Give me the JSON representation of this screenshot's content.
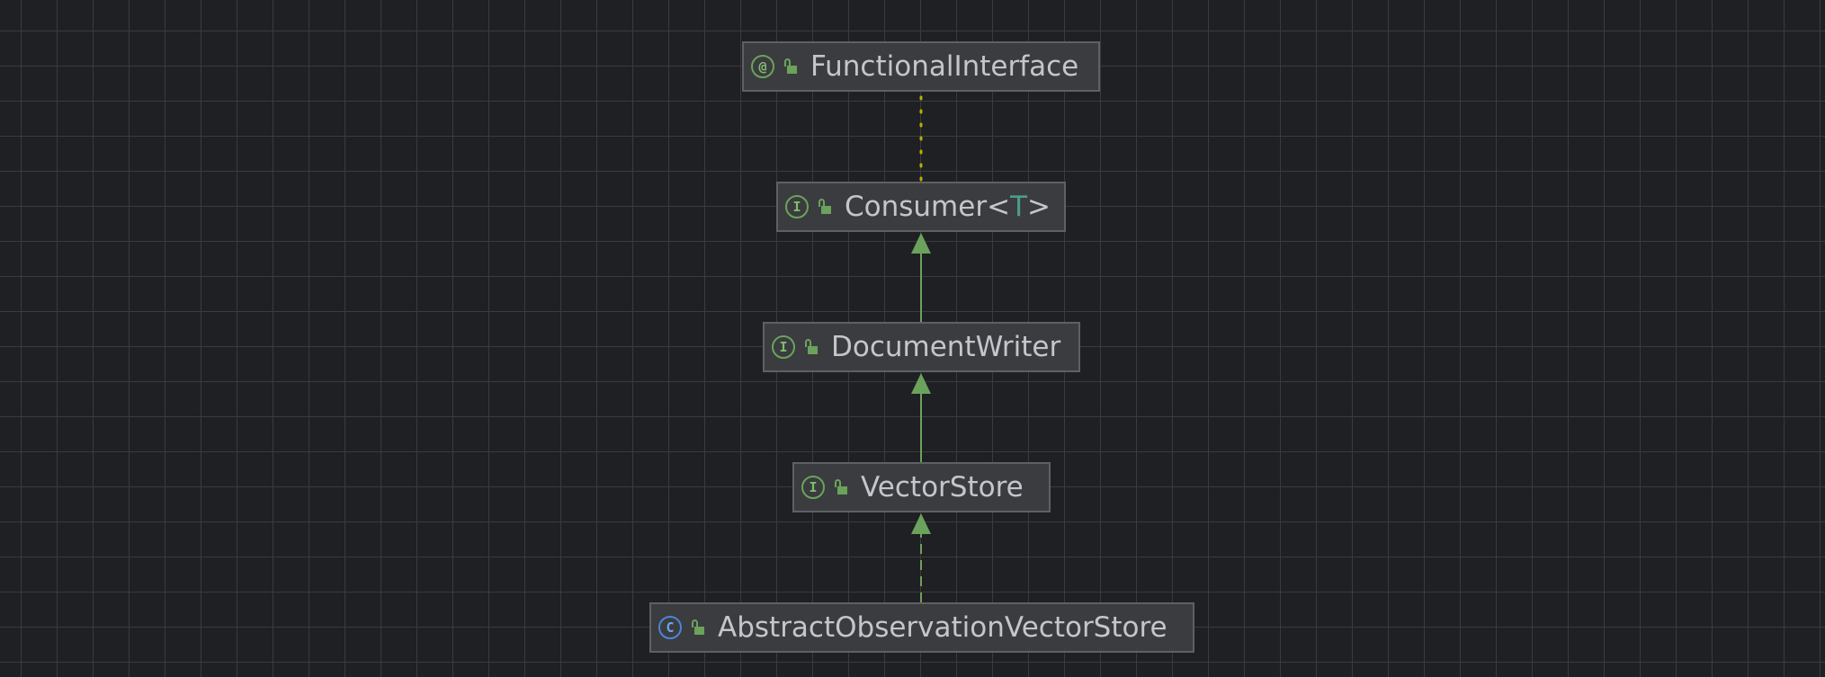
{
  "diagram": {
    "nodes": [
      {
        "id": "functional-interface",
        "kind": "annotation",
        "kind_glyph": "@",
        "visibility_icon": "unlocked-icon",
        "label": "FunctionalInterface"
      },
      {
        "id": "consumer",
        "kind": "interface",
        "kind_glyph": "I",
        "visibility_icon": "unlocked-icon",
        "label": "Consumer<",
        "type_param": "T",
        "label_suffix": ">"
      },
      {
        "id": "document-writer",
        "kind": "interface",
        "kind_glyph": "I",
        "visibility_icon": "unlocked-icon",
        "label": "DocumentWriter"
      },
      {
        "id": "vector-store",
        "kind": "interface",
        "kind_glyph": "I",
        "visibility_icon": "unlocked-icon",
        "label": "VectorStore"
      },
      {
        "id": "abstract-observation-vector-store",
        "kind": "class",
        "kind_glyph": "C",
        "visibility_icon": "unlocked-icon",
        "label": "AbstractObservationVectorStore"
      }
    ],
    "edges": [
      {
        "from": "consumer",
        "to": "functional-interface",
        "relation": "annotated-by",
        "style": "dotted",
        "color": "#b8b000"
      },
      {
        "from": "document-writer",
        "to": "consumer",
        "relation": "extends",
        "style": "solid",
        "color": "#6ba25c"
      },
      {
        "from": "vector-store",
        "to": "document-writer",
        "relation": "extends",
        "style": "solid",
        "color": "#6ba25c"
      },
      {
        "from": "abstract-observation-vector-store",
        "to": "vector-store",
        "relation": "implements",
        "style": "dashed",
        "color": "#6ba25c"
      }
    ]
  },
  "colors": {
    "background": "#1f2023",
    "grid": "#3a3b3f",
    "node_fill": "#3b3c3f",
    "node_border": "#5e6064",
    "text": "#c3c6cc",
    "interface_accent": "#6ba25c",
    "class_accent": "#4a86d6",
    "annotation_edge": "#b8b000",
    "type_parameter": "#4e9b8f"
  }
}
